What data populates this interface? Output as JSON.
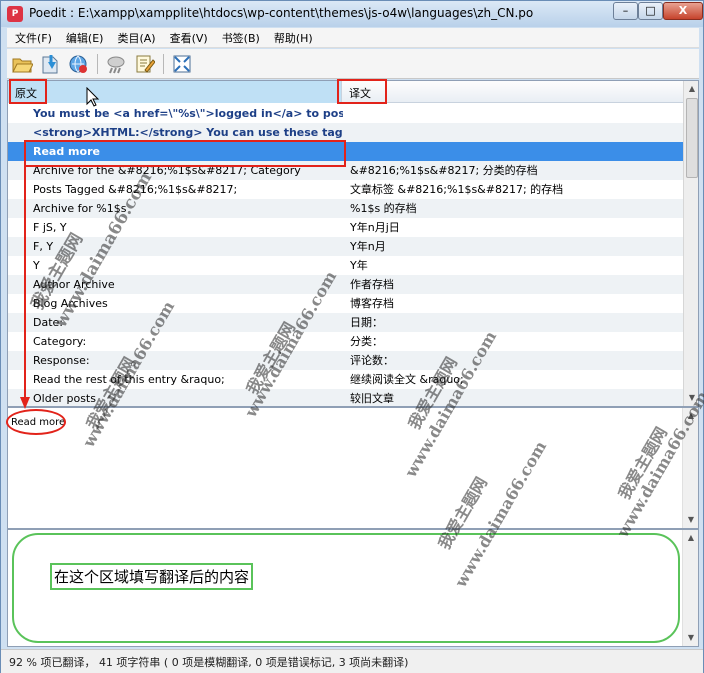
{
  "window": {
    "title": "Poedit : E:\\xampp\\xampplite\\htdocs\\wp-content\\themes\\js-o4w\\languages\\zh_CN.po",
    "icon_text": "P",
    "min": "–",
    "max": "□",
    "close": "X"
  },
  "menu": [
    "文件(F)",
    "编辑(E)",
    "类目(A)",
    "查看(V)",
    "书签(B)",
    "帮助(H)"
  ],
  "toolbar": [
    "open-icon",
    "save-icon",
    "update-catalog-icon",
    "validate-icon",
    "comment-icon",
    "fullscreen-icon"
  ],
  "list": {
    "col_original": "原文",
    "col_translation": "译文",
    "rows": [
      {
        "o": "You must be <a href=\\\"%s\\\">logged in</a> to post a ...",
        "t": "",
        "style": "header"
      },
      {
        "o": "<strong>XHTML:</strong> You can use these tags: <c...",
        "t": "",
        "style": "header"
      },
      {
        "o": "Read more",
        "t": "",
        "style": "selected"
      },
      {
        "o": "Archive for the &#8216;%1$s&#8217; Category",
        "t": "&#8216;%1$s&#8217; 分类的存档"
      },
      {
        "o": "Posts Tagged &#8216;%1$s&#8217;",
        "t": "文章标签 &#8216;%1$s&#8217; 的存档"
      },
      {
        "o": "Archive for %1$s",
        "t": "%1$s 的存档"
      },
      {
        "o": "F jS, Y",
        "t": "Y年n月j日"
      },
      {
        "o": "F, Y",
        "t": "Y年n月"
      },
      {
        "o": "Y",
        "t": "Y年"
      },
      {
        "o": "Author Archive",
        "t": "作者存档"
      },
      {
        "o": "Blog Archives",
        "t": "博客存档"
      },
      {
        "o": "Date:",
        "t": "日期："
      },
      {
        "o": "Category:",
        "t": "分类："
      },
      {
        "o": "Response:",
        "t": "评论数："
      },
      {
        "o": "Read the rest of this entry &raquo;",
        "t": "继续阅读全文 &raquo;"
      },
      {
        "o": "Older posts",
        "t": "较旧文章"
      }
    ]
  },
  "source_text": "Read more",
  "annotation_text": "在这个区域填写翻译后的内容",
  "status": "92 % 项已翻译， 41 项字符串 ( 0 项是模糊翻译, 0 项是错误标记, 3 项尚未翻译)",
  "watermarks": {
    "site": "www.daima66.com",
    "name": "我爱主题网"
  },
  "colors": {
    "selected_row": "#3b8ee8",
    "annotation_red": "#e2231a",
    "annotation_green": "#5ac35a",
    "header_text": "#1d3f86"
  }
}
